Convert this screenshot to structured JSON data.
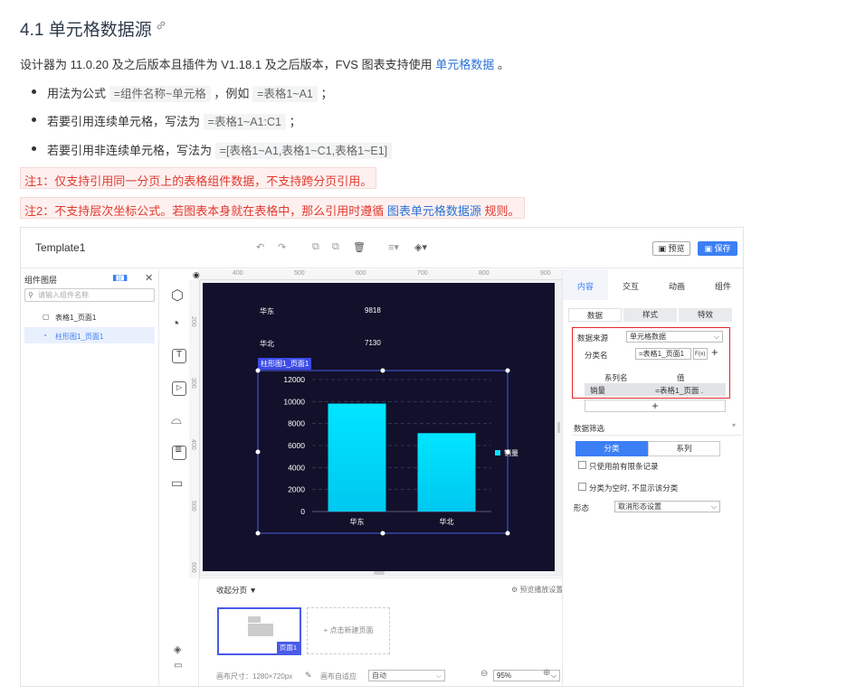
{
  "doc": {
    "heading": "4.1 单元格数据源",
    "intro_before": "设计器为 11.0.20 及之后版本且插件为 V1.18.1 及之后版本，FVS 图表支持使用",
    "intro_link": "单元格数据",
    "intro_after": "。",
    "bullets": [
      {
        "pre": "用法为公式",
        "code": "=组件名称~单元格",
        "mid": "，例如",
        "code2": "=表格1~A1",
        "post": "；"
      },
      {
        "pre": "若要引用连续单元格，写法为",
        "code": "=表格1~A1:C1",
        "post": "；"
      },
      {
        "pre": "若要引用非连续单元格，写法为",
        "code": "=[表格1~A1,表格1~C1,表格1~E1]"
      }
    ],
    "note1": "注1：仅支持引用同一分页上的表格组件数据，不支持跨分页引用。",
    "note2_before": "注2：不支持层次坐标公式。若图表本身就在表格中，那么引用时遵循",
    "note2_link": "图表单元格数据源",
    "note2_after": "规则。"
  },
  "app": {
    "template_name": "Template1",
    "preview_label": "预览",
    "save_label": "保存",
    "layers_title": "组件图层",
    "search_placeholder": "请输入组件名称",
    "layers": [
      "表格1_页面1",
      "柱形图1_页面1"
    ],
    "ruler_top": [
      "400",
      "500",
      "600",
      "700",
      "800",
      "900"
    ],
    "ruler_left": [
      "200",
      "300",
      "400",
      "500",
      "600"
    ],
    "table_rows": [
      [
        "华东",
        "9818"
      ],
      [
        "华北",
        "7130"
      ]
    ],
    "chart_selected_label": "柱形图1_页面1",
    "bottom": {
      "collapse_label": "收起分页",
      "playback_label": "预览播放设置",
      "page_label": "页面1",
      "new_page_label": "+ 点击新建页面",
      "canvas_size_label": "画布尺寸：1280×720px",
      "adapt_label": "画布自适应",
      "adapt_value": "自动",
      "zoom_value": "95%"
    },
    "right": {
      "tabs": [
        "内容",
        "交互",
        "动画",
        "组件"
      ],
      "subtabs": [
        "数据",
        "样式",
        "特效"
      ],
      "source_label": "数据来源",
      "source_value": "单元格数据",
      "category_label": "分类名",
      "category_value": "=表格1_页面1",
      "fx_label": "F(x)",
      "series_header": "系列名",
      "value_header": "值",
      "series_name": "销量",
      "series_value": "=表格1_页面 .",
      "filter_label": "数据筛选",
      "toggle_left": "分类",
      "toggle_right": "系列",
      "check1": "只使用前有限条记录",
      "check2": "分类为空时, 不显示该分类",
      "shape_label": "形态",
      "shape_value": "取消形态设置"
    },
    "colors": {
      "accent": "#3c7ff5",
      "canvas_bg": "#12102a",
      "bar": "#00e5ff",
      "note_red": "#e03a2f"
    }
  },
  "chart_data": {
    "type": "bar",
    "categories": [
      "华东",
      "华北"
    ],
    "series": [
      {
        "name": "销量",
        "values": [
          9818,
          7130
        ]
      }
    ],
    "y_ticks": [
      "12000",
      "10000",
      "8000",
      "6000",
      "4000",
      "2000",
      "0"
    ],
    "ylim": [
      0,
      12000
    ],
    "legend": "right"
  }
}
